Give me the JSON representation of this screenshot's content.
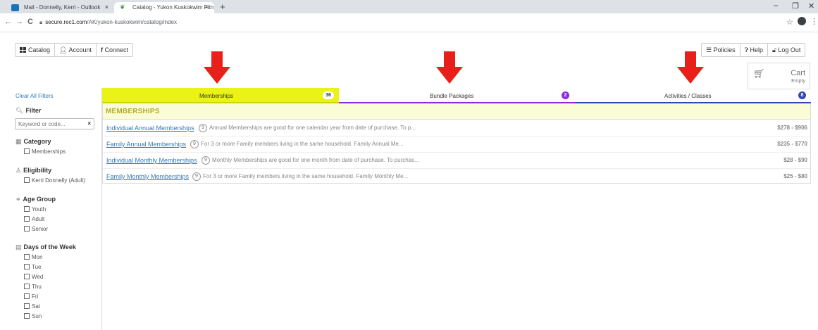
{
  "browser": {
    "tabs": [
      {
        "title": "Mail - Donnelly, Kerri - Outlook",
        "close": "×"
      },
      {
        "title": "Catalog - Yukon Kuskokwim Fitn",
        "close": "×"
      }
    ],
    "new_tab": "+",
    "window_controls": {
      "minimize": "–",
      "restore": "❐",
      "close": "✕"
    },
    "nav": {
      "back": "←",
      "forward": "→",
      "reload": "C"
    },
    "url_host": "secure.rec1.com",
    "url_path": "/AK/yukon-kuskokwim/catalog/index",
    "bookmark_star": "☆",
    "menu": "⋮"
  },
  "topnav": {
    "catalog": "Catalog",
    "account": "Account",
    "connect": "Connect",
    "policies": "Policies",
    "help": "Help",
    "logout": "Log Out"
  },
  "cart": {
    "title": "Cart",
    "status": "Empty"
  },
  "sidebar": {
    "clear_all": "Clear All Filters",
    "filter_heading": "Filter",
    "keyword_placeholder": "Keyword or code...",
    "keyword_clear": "×",
    "category_heading": "Category",
    "category_options": [
      "Memberships"
    ],
    "eligibility_heading": "Eligibility",
    "eligibility_options": [
      "Kerri Donnelly (Adult)"
    ],
    "age_heading": "Age Group",
    "age_options": [
      "Youth",
      "Adult",
      "Senior"
    ],
    "days_heading": "Days of the Week",
    "days_options": [
      "Mon",
      "Tue",
      "Wed",
      "Thu",
      "Fri",
      "Sat",
      "Sun"
    ]
  },
  "category_tabs": [
    {
      "label": "Memberships",
      "count": "36",
      "color": "#eaf315"
    },
    {
      "label": "Bundle Packages",
      "count": "2",
      "color": "#8a2be2"
    },
    {
      "label": "Activities / Classes",
      "count": "8",
      "color": "#2f48b5"
    }
  ],
  "section_heading": "MEMBERSHIPS",
  "memberships": [
    {
      "name": "Individual Annual Memberships",
      "count": "9",
      "desc": "Annual Memberships are good for one calendar year from date of purchase. To p...",
      "price": "$278 - $906"
    },
    {
      "name": "Family Annual Memberships",
      "count": "9",
      "desc": "For 3 or more Family members living in the same household. Family Annual Me...",
      "price": "$235 - $770"
    },
    {
      "name": "Individual Monthly Memberships",
      "count": "9",
      "desc": "Monthly Memberships are good for one month from date of purchase. To purchas...",
      "price": "$28 - $90"
    },
    {
      "name": "Family Monthly Memberships",
      "count": "9",
      "desc": "For 3 or more Family members living in the same household. Family Monthly Me...",
      "price": "$25 - $80"
    }
  ],
  "colors": {
    "arrow": "#e8201a",
    "link": "#337ab7",
    "heading": "#b5a92b"
  }
}
